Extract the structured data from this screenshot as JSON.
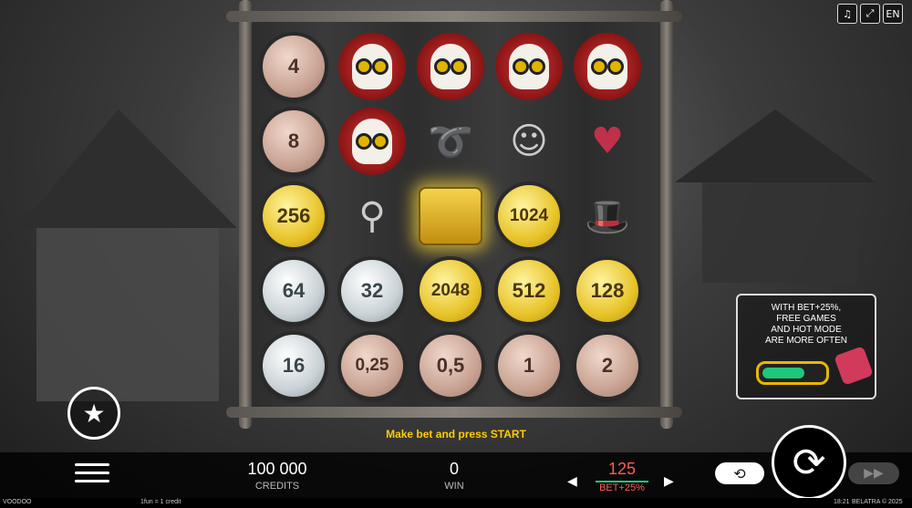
{
  "top_icons": {
    "sound": "♫",
    "fullscreen": "⤢",
    "language": "EN"
  },
  "grid": [
    [
      {
        "type": "coin",
        "tier": "bronze",
        "value": "4"
      },
      {
        "type": "skull"
      },
      {
        "type": "skull"
      },
      {
        "type": "skull"
      },
      {
        "type": "skull"
      }
    ],
    [
      {
        "type": "coin",
        "tier": "bronze",
        "value": "8"
      },
      {
        "type": "skull"
      },
      {
        "type": "knot"
      },
      {
        "type": "voodoo-doll"
      },
      {
        "type": "heart-pins"
      }
    ],
    [
      {
        "type": "coin",
        "tier": "gold",
        "value": "256"
      },
      {
        "type": "pouch"
      },
      {
        "type": "chest"
      },
      {
        "type": "coin",
        "tier": "gold",
        "value": "1024"
      },
      {
        "type": "top-hat"
      }
    ],
    [
      {
        "type": "coin",
        "tier": "silver",
        "value": "64"
      },
      {
        "type": "coin",
        "tier": "silver",
        "value": "32"
      },
      {
        "type": "coin",
        "tier": "gold",
        "value": "2048"
      },
      {
        "type": "coin",
        "tier": "gold",
        "value": "512"
      },
      {
        "type": "coin",
        "tier": "gold",
        "value": "128"
      }
    ],
    [
      {
        "type": "coin",
        "tier": "silver",
        "value": "16"
      },
      {
        "type": "coin",
        "tier": "bronze",
        "value": "0,25"
      },
      {
        "type": "coin",
        "tier": "bronze",
        "value": "0,5"
      },
      {
        "type": "coin",
        "tier": "bronze",
        "value": "1"
      },
      {
        "type": "coin",
        "tier": "bronze",
        "value": "2"
      }
    ]
  ],
  "message": "Make bet and press START",
  "promo": {
    "line1": "WITH BET+25%,",
    "line2": "FREE GAMES",
    "line3": "AND HOT MODE",
    "line4": "ARE MORE OFTEN"
  },
  "bottom": {
    "credits_value": "100 000",
    "credits_label": "CREDITS",
    "win_value": "0",
    "win_label": "WIN",
    "bet_value": "125",
    "bet_label": "BET+25%",
    "bet_left": "◀",
    "bet_right": "▶"
  },
  "buttons": {
    "star": "★",
    "spin": "⟳",
    "auto": "⟲",
    "turbo": "▶▶"
  },
  "footer": {
    "game": "VOODOO",
    "rate": "1fun = 1 credit",
    "time": "18:21",
    "copyright": "BELATRA © 2025"
  },
  "colors": {
    "message": "#ffcc00",
    "bet_value": "#ff5a5a",
    "bet_label": "#ff5a5a",
    "toggle_fill": "#1fc77a"
  }
}
